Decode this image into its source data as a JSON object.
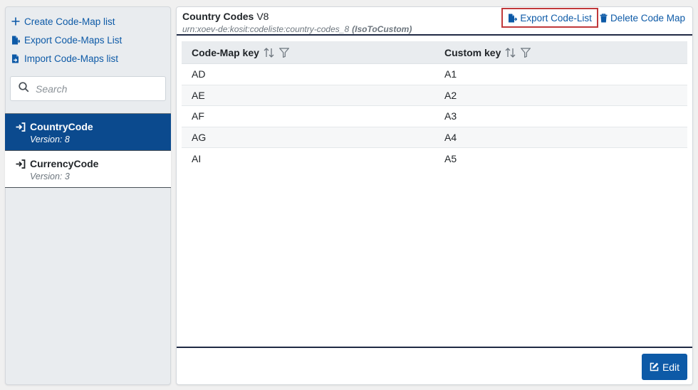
{
  "sidebar": {
    "actions": [
      {
        "label": "Create Code-Map list",
        "icon": "plus-icon"
      },
      {
        "label": "Export Code-Maps List",
        "icon": "file-export-icon"
      },
      {
        "label": "Import Code-Maps list",
        "icon": "file-import-icon"
      }
    ],
    "search": {
      "placeholder": "Search"
    },
    "items": [
      {
        "name": "CountryCode",
        "version": "Version: 8",
        "active": true
      },
      {
        "name": "CurrencyCode",
        "version": "Version: 3",
        "active": false
      }
    ]
  },
  "panel": {
    "title": "Country Codes",
    "version": "V8",
    "urn": "urn:xoev-de:kosit:codeliste:country-codes_8",
    "mapping_type": "(IsoToCustom)",
    "export_label": "Export Code-List",
    "delete_label": "Delete Code Map",
    "edit_label": "Edit"
  },
  "table": {
    "headers": [
      "Code-Map key",
      "Custom key"
    ],
    "rows": [
      [
        "AD",
        "A1"
      ],
      [
        "AE",
        "A2"
      ],
      [
        "AF",
        "A3"
      ],
      [
        "AG",
        "A4"
      ],
      [
        "AI",
        "A5"
      ]
    ]
  },
  "colors": {
    "accent": "#0d5aa7",
    "active_item": "#0b4a8e",
    "highlight_outline": "#c0393b"
  }
}
